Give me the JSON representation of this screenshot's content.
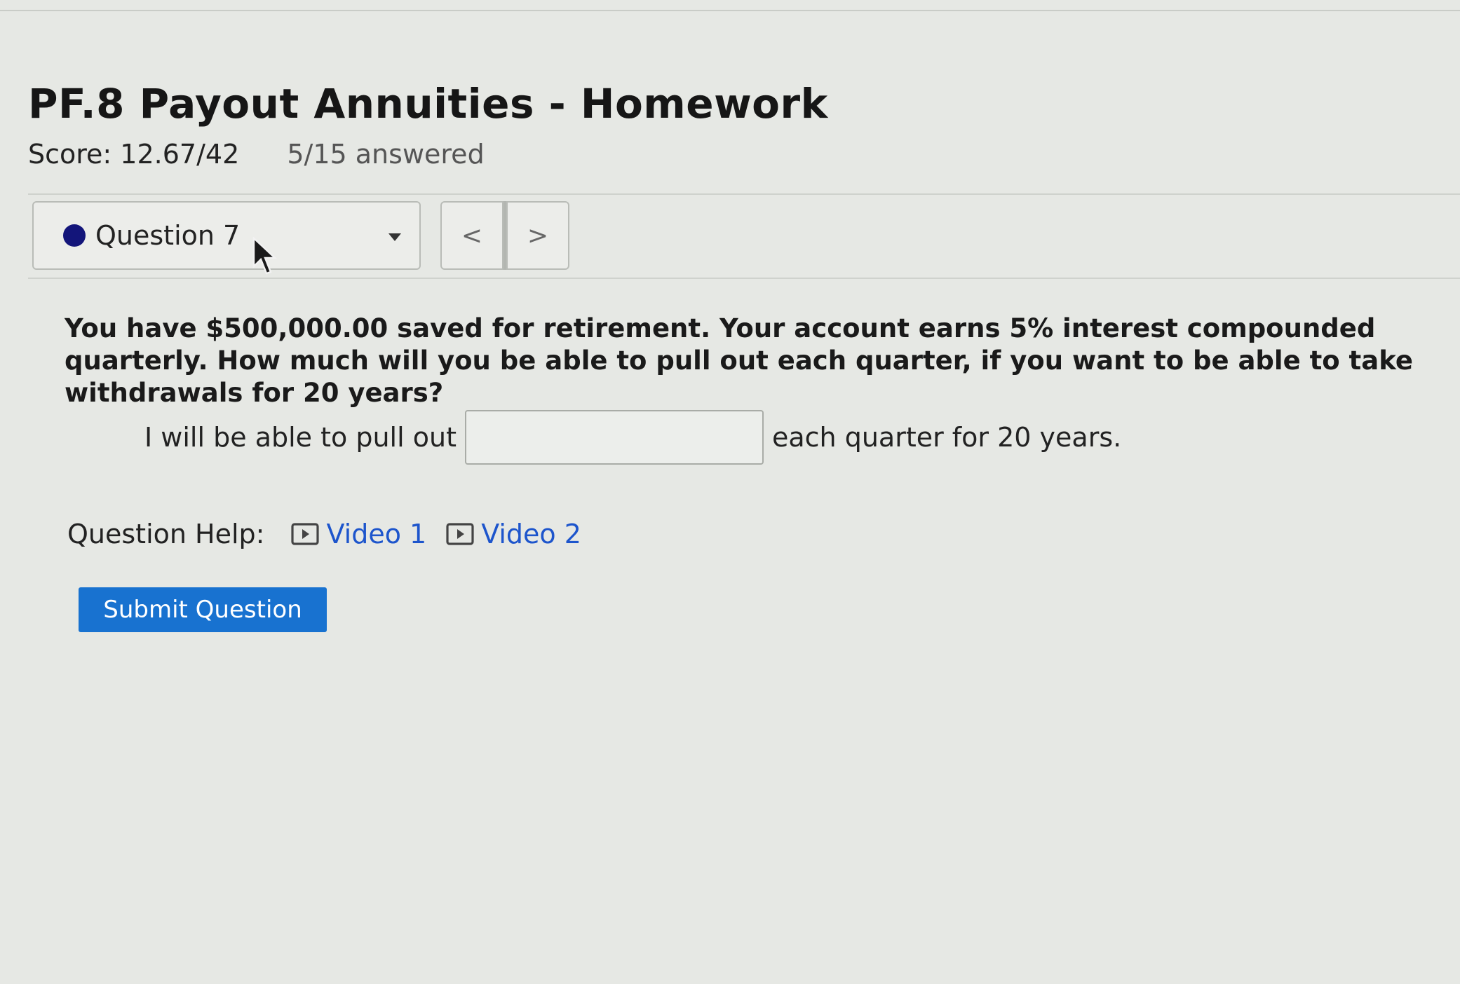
{
  "assignment": {
    "title": "PF.8 Payout Annuities - Homework",
    "score": "Score: 12.67/42",
    "answered": "5/15 answered"
  },
  "navigation": {
    "current_question": "Question 7",
    "prev_glyph": "<",
    "next_glyph": ">",
    "status_color": "#13157a"
  },
  "question": {
    "text": "You have $500,000.00 saved for retirement. Your account earns 5% interest compounded quarterly. How much will you be able to pull out each quarter, if you want to be able to take withdrawals for 20 years?",
    "answer_prefix": "I will be able to pull out",
    "answer_value": "",
    "answer_suffix": "each quarter for 20 years."
  },
  "help": {
    "label": "Question Help:",
    "links": [
      {
        "icon": "video-icon",
        "label": "Video 1"
      },
      {
        "icon": "video-icon",
        "label": "Video 2"
      }
    ],
    "link_color": "#1d55cc"
  },
  "actions": {
    "submit_label": "Submit Question",
    "submit_color": "#1872d0"
  }
}
